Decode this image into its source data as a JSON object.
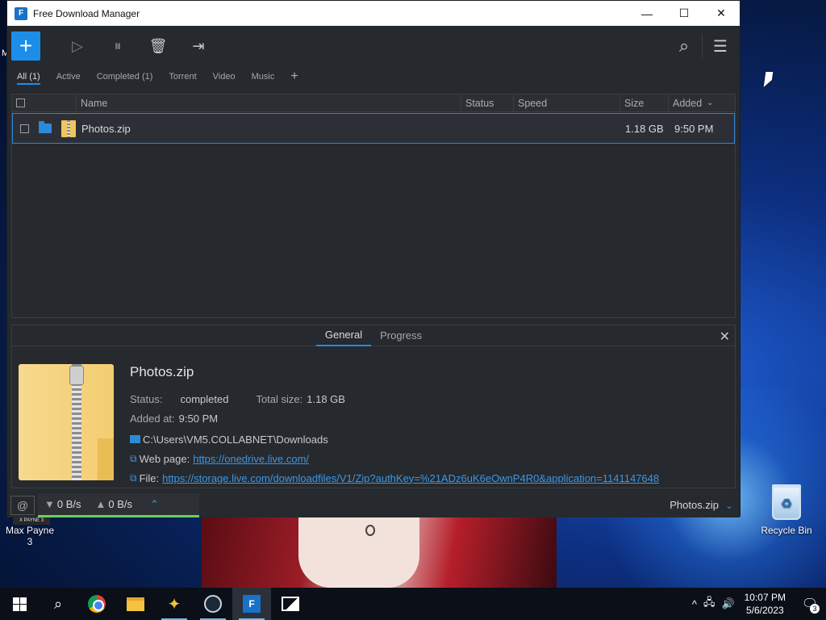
{
  "window": {
    "title": "Free Download Manager",
    "logo_glyph": "F",
    "controls": {
      "minimize": "—",
      "maximize": "☐",
      "close": "✕"
    }
  },
  "toolbar": {
    "add_glyph": "+",
    "resume_glyph": "▷",
    "pause_glyph": "⏸",
    "delete_glyph": "🗑",
    "move_glyph": "⇥",
    "search_glyph": "⌕",
    "menu_glyph": "☰"
  },
  "filters": {
    "all": "All (1)",
    "active": "Active",
    "completed": "Completed (1)",
    "torrent": "Torrent",
    "video": "Video",
    "music": "Music",
    "add": "+"
  },
  "table": {
    "columns": {
      "name": "Name",
      "status": "Status",
      "speed": "Speed",
      "size": "Size",
      "added": "Added",
      "sort_glyph": "⌄"
    },
    "rows": [
      {
        "name": "Photos.zip",
        "status": "",
        "speed": "",
        "size": "1.18 GB",
        "added": "9:50 PM"
      }
    ]
  },
  "details": {
    "tabs": {
      "general": "General",
      "progress": "Progress"
    },
    "close_glyph": "✕",
    "file_name": "Photos.zip",
    "status_label": "Status:",
    "status_value": "completed",
    "total_label": "Total size:",
    "total_value": "1.18 GB",
    "added_label": "Added at:",
    "added_value": "9:50 PM",
    "path": "C:\\Users\\VM5.COLLABNET\\Downloads",
    "webpage_label": "Web page:",
    "webpage_url": "https://onedrive.live.com/",
    "file_label": "File:",
    "file_url": "https://storage.live.com/downloadfiles/V1/Zip?authKey=%21ADz6uK6eOwnP4R0&application=1141147648"
  },
  "statusbar": {
    "snail_glyph": "@",
    "down_glyph": "▼",
    "down_speed": "0 B/s",
    "up_glyph": "▲",
    "up_speed": "0 B/s",
    "expand_glyph": "⌃",
    "current_file": "Photos.zip",
    "chevron_glyph": "⌄"
  },
  "desktop": {
    "stray_text": "M",
    "recycle_bin": "Recycle Bin",
    "max_payne": "Max Payne 3",
    "max_payne_thumb": "X PAYNE 3"
  },
  "taskbar": {
    "search_glyph": "⌕",
    "tray_chevron": "^",
    "network_glyph": "🖧",
    "volume_glyph": "🔊",
    "time": "10:07 PM",
    "date": "5/6/2023",
    "notif_glyph": "🗨",
    "notif_count": "3"
  }
}
